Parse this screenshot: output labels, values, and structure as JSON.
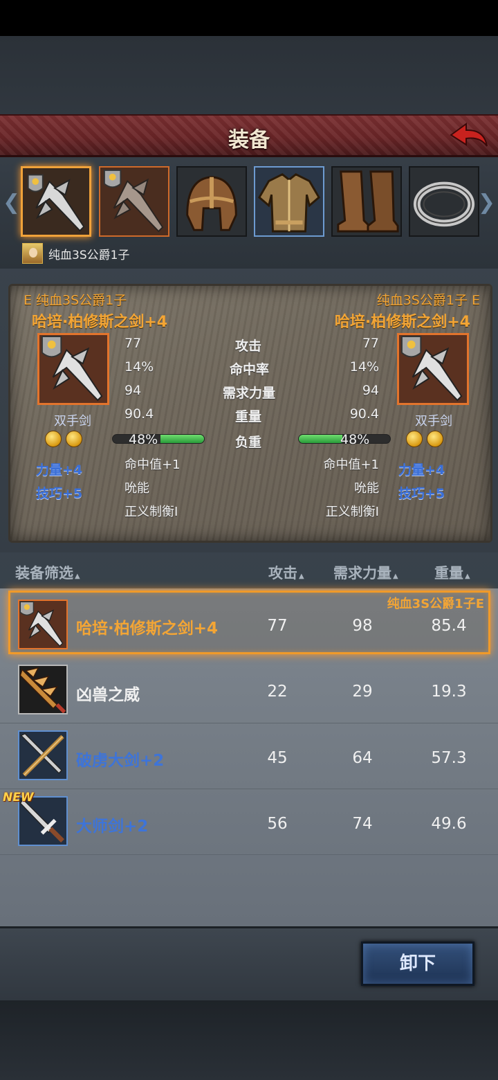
{
  "header": {
    "title": "装备"
  },
  "owner": {
    "name": "纯血3S公爵1子"
  },
  "compare": {
    "left": {
      "top_label": "E 纯血3S公爵1子",
      "name": "哈培·柏修斯之剑+4",
      "type": "双手剑",
      "attack": "77",
      "hit_rate": "14%",
      "str_req": "94",
      "weight": "90.4",
      "load": "48%",
      "load_fraction": 0.48,
      "bonus": [
        "力量+4",
        "技巧+5"
      ]
    },
    "right": {
      "top_label": "纯血3S公爵1子 E",
      "name": "哈培·柏修斯之剑+4",
      "type": "双手剑",
      "attack": "77",
      "hit_rate": "14%",
      "str_req": "94",
      "weight": "90.4",
      "load": "48%",
      "load_fraction": 0.48,
      "bonus": [
        "力量+4",
        "技巧+5"
      ]
    },
    "labels": {
      "attack": "攻击",
      "hit_rate": "命中率",
      "str_req": "需求力量",
      "weight": "重量",
      "load": "负重"
    },
    "effects_left": [
      "命中值+1",
      "吮能",
      "正义制衡I"
    ],
    "effects_right": [
      "命中值+1",
      "吮能",
      "正义制衡I"
    ]
  },
  "list": {
    "headers": {
      "filter": "装备筛选",
      "attack": "攻击",
      "str_req": "需求力量",
      "weight": "重量",
      "tri": "▲"
    },
    "rows": [
      {
        "name": "哈培·柏修斯之剑+4",
        "attack": "77",
        "str_req": "98",
        "weight": "85.4",
        "owner": "纯血3S公爵1子E",
        "color": "#f3a535"
      },
      {
        "name": "凶兽之威",
        "attack": "22",
        "str_req": "29",
        "weight": "19.3",
        "color": "#f0f0f0"
      },
      {
        "name": "破虏大剑+2",
        "attack": "45",
        "str_req": "64",
        "weight": "57.3",
        "color": "#3e74d8"
      },
      {
        "name": "大师剑+2",
        "attack": "56",
        "str_req": "74",
        "weight": "49.6",
        "badge": "NEW",
        "color": "#3e74d8"
      }
    ]
  },
  "footer": {
    "unload": "卸下"
  },
  "icons": {
    "back": "back-arrow-icon",
    "slots": [
      "two-handed-sword-icon",
      "two-handed-sword-icon",
      "helmet-icon",
      "armor-icon",
      "boots-icon",
      "ring-icon"
    ]
  }
}
